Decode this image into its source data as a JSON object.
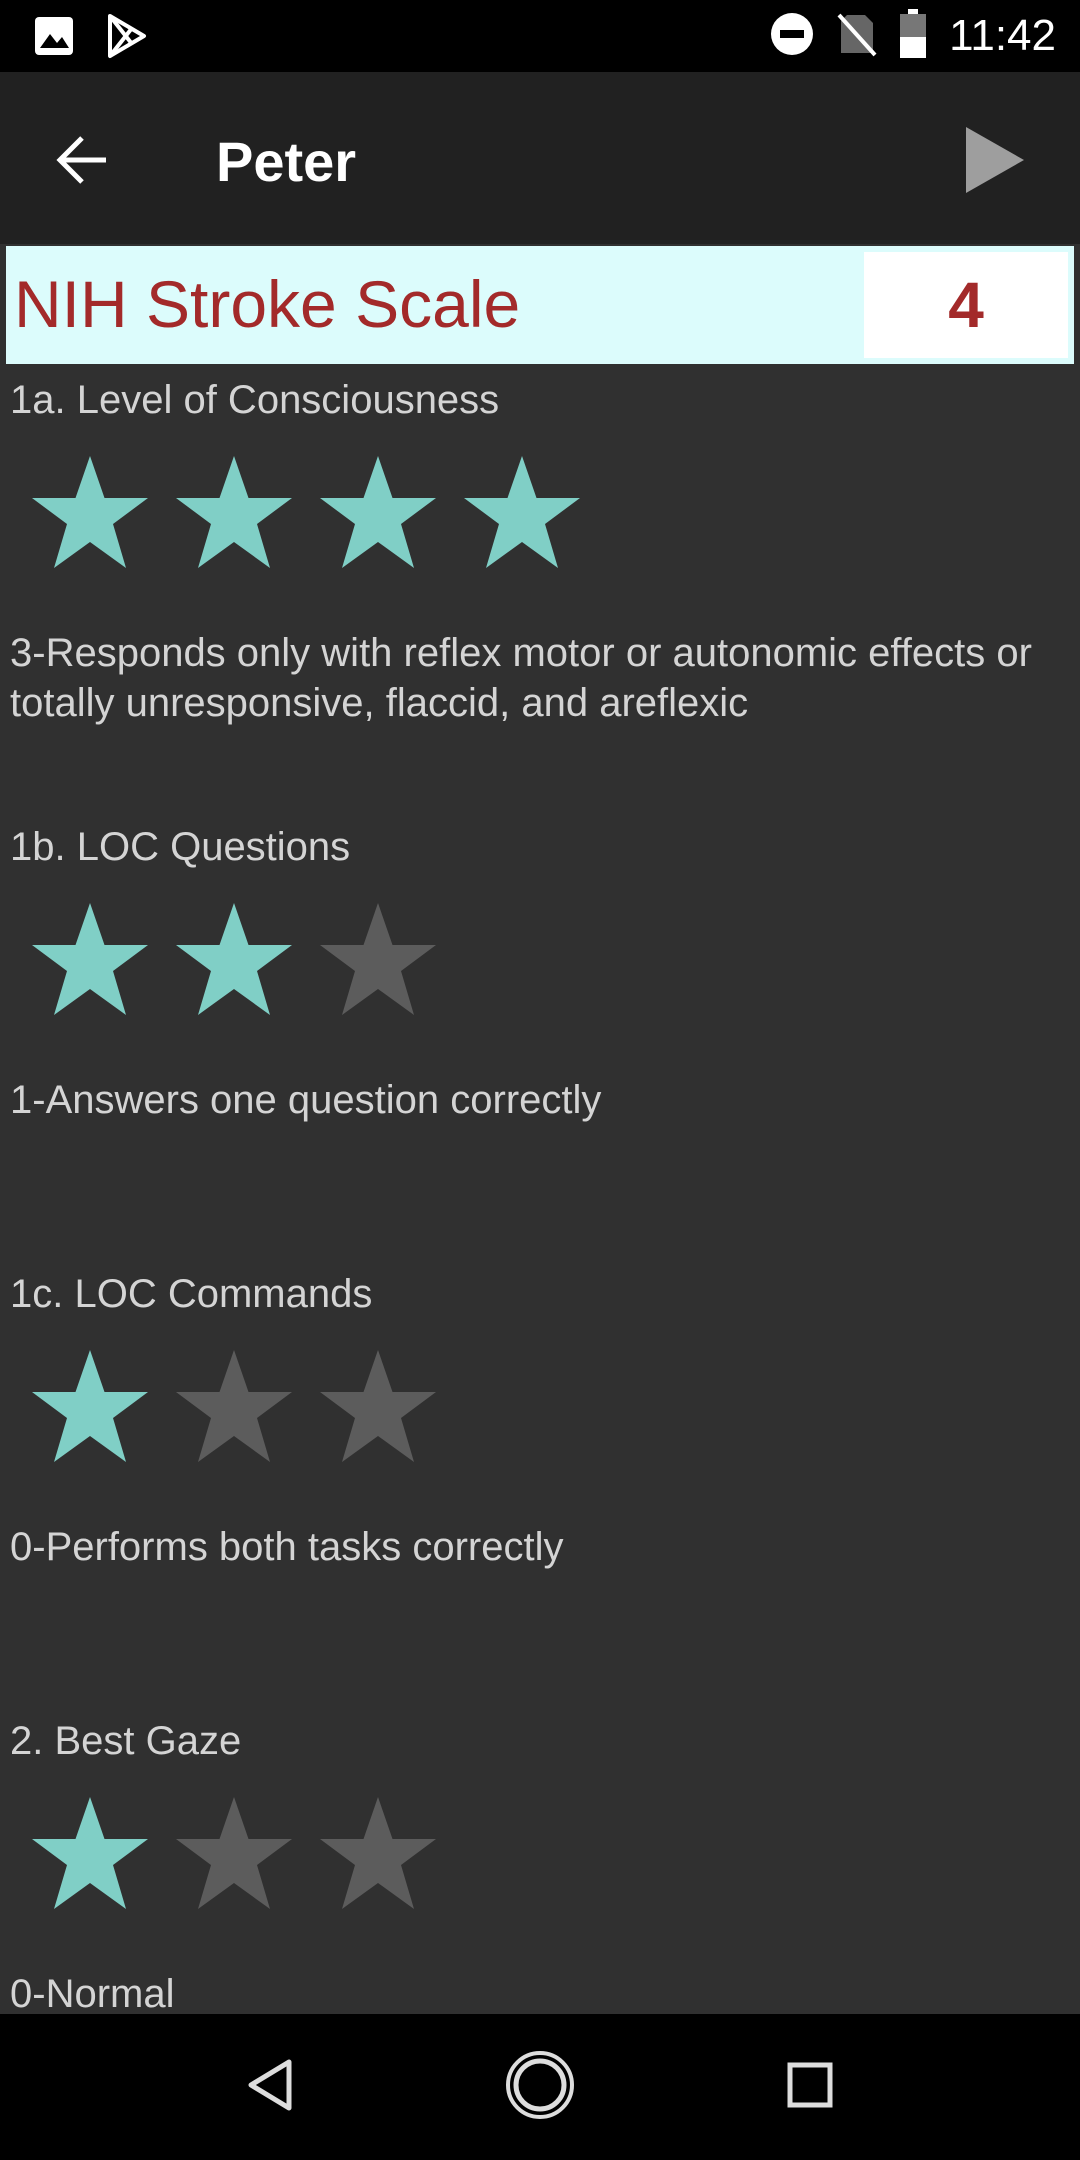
{
  "status_bar": {
    "time": "11:42",
    "icons": [
      "image-icon",
      "play-store-icon",
      "do-not-disturb-icon",
      "no-sim-icon",
      "battery-icon"
    ]
  },
  "app_bar": {
    "title": "Peter"
  },
  "scale": {
    "title": "NIH Stroke Scale",
    "total_score": "4"
  },
  "colors": {
    "star_active": "#80cfc6",
    "star_inactive": "#5c5c5c",
    "header_bg": "#dcfcfc",
    "accent_red": "#a32a2a"
  },
  "items": [
    {
      "label": "1a. Level of Consciousness",
      "max_stars": 4,
      "selected_stars": 4,
      "description": "3-Responds only with reflex motor or autonomic effects or totally unresponsive, flaccid, and areflexic"
    },
    {
      "label": "1b. LOC Questions",
      "max_stars": 3,
      "selected_stars": 2,
      "description": "1-Answers one question correctly"
    },
    {
      "label": "1c. LOC Commands",
      "max_stars": 3,
      "selected_stars": 1,
      "description": "0-Performs both tasks correctly"
    },
    {
      "label": "2. Best Gaze",
      "max_stars": 3,
      "selected_stars": 1,
      "description": "0-Normal"
    }
  ]
}
